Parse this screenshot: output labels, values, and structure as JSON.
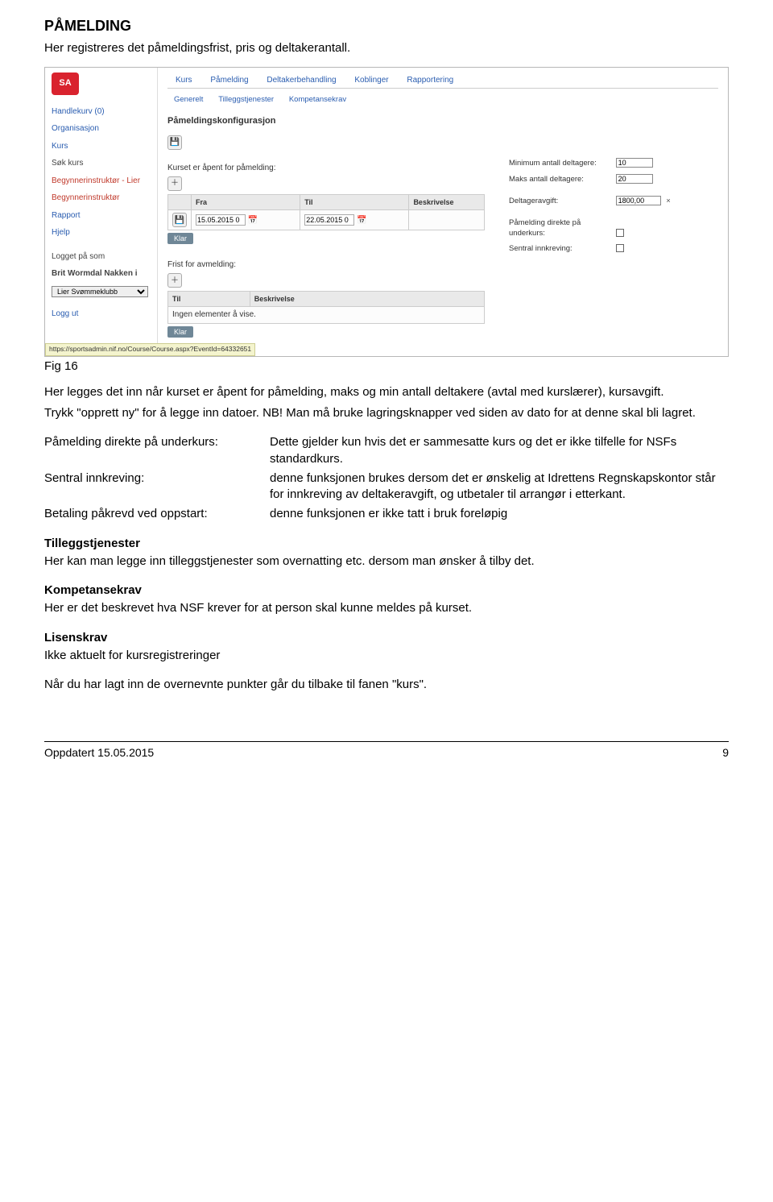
{
  "heading": "PÅMELDING",
  "intro": "Her registreres det påmeldingsfrist, pris og deltakerantall.",
  "figLabel": "Fig 16",
  "screenshot": {
    "sidebar": {
      "logoText": "SA",
      "items": [
        "Handlekurv (0)",
        "Organisasjon",
        "Kurs",
        "Søk kurs",
        "Begynnerinstruktør - Lier",
        "Begynnerinstruktør",
        "Rapport",
        "Hjelp"
      ],
      "loggedLabel": "Logget på som",
      "user": "Brit Wormdal Nakken i",
      "clubSelect": "Lier Svømmeklubb",
      "logout": "Logg ut"
    },
    "tabs": [
      "Kurs",
      "Påmelding",
      "Deltakerbehandling",
      "Koblinger",
      "Rapportering"
    ],
    "subtabs": [
      "Generelt",
      "Tilleggstjenester",
      "Kompetansekrav"
    ],
    "sectionTitle": "Påmeldingskonfigurasjon",
    "openLabel": "Kurset er åpent for påmelding:",
    "table1": {
      "hFra": "Fra",
      "hTil": "Til",
      "hBeskr": "Beskrivelse",
      "v1": "15.05.2015 0",
      "v2": "22.05.2015 0"
    },
    "klar": "Klar",
    "avmelding": "Frist for avmelding:",
    "table2Empty": "Ingen elementer å vise.",
    "right": {
      "minLabel": "Minimum antall deltagere:",
      "minVal": "10",
      "maxLabel": "Maks antall deltagere:",
      "maxVal": "20",
      "feeLabel": "Deltageravgift:",
      "feeVal": "1800,00",
      "direkteLabel": "Påmelding direkte på underkurs:",
      "sentralLabel": "Sentral innkreving:"
    },
    "urlbar": "https://sportsadmin.nif.no/Course/Course.aspx?EventId=64332651"
  },
  "para1": "Her legges det inn når kurset er åpent for påmelding, maks og min antall deltakere (avtal med kurslærer), kursavgift.",
  "para2": "Trykk \"opprett ny\" for å legge inn datoer. NB! Man må bruke lagringsknapper ved siden av dato for at denne skal bli lagret.",
  "defs": {
    "t1": "Påmelding direkte på underkurs:",
    "d1": "Dette gjelder kun hvis det er sammesatte kurs og det er ikke tilfelle for NSFs standardkurs.",
    "t2": "Sentral innkreving:",
    "d2": "denne funksjonen brukes dersom det er ønskelig at Idrettens Regnskapskontor står for innkreving av deltakeravgift, og utbetaler til arrangør i etterkant.",
    "t3": "Betaling påkrevd ved oppstart:",
    "d3": "denne funksjonen er ikke tatt i bruk foreløpig"
  },
  "tillegg": {
    "h": "Tilleggstjenester",
    "p": "Her kan man legge inn tilleggstjenester som overnatting etc. dersom man ønsker å tilby det."
  },
  "kompetanse": {
    "h": "Kompetansekrav",
    "p": "Her er det beskrevet hva NSF krever for at person skal kunne meldes på kurset."
  },
  "lisens": {
    "h": "Lisenskrav",
    "p": "Ikke aktuelt for kursregistreringer"
  },
  "closing": "Når du har lagt inn de overnevnte punkter går du tilbake til fanen \"kurs\".",
  "footer": {
    "left": "Oppdatert 15.05.2015",
    "right": "9"
  }
}
